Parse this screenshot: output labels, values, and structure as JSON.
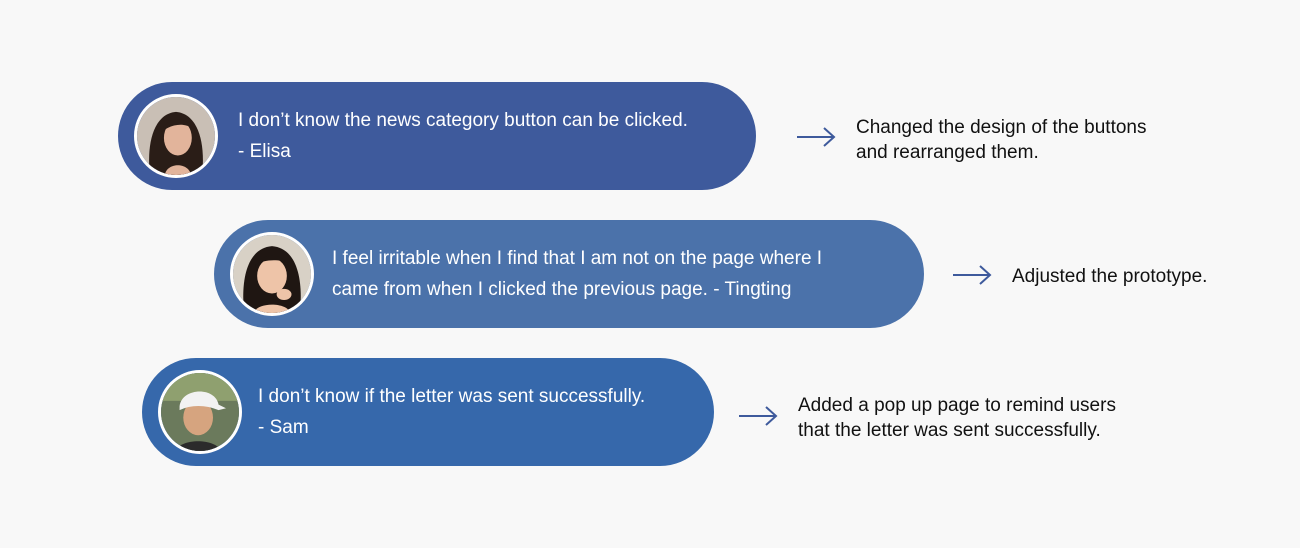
{
  "feedback": [
    {
      "quote": "I don’t know the news category button can be clicked.",
      "author": "- Elisa",
      "response_line1": "Changed the design of the buttons",
      "response_line2": "and rearranged them.",
      "pill_color": "#3e5a9c"
    },
    {
      "quote_line1": "I feel irritable when I find that I am not on the page where I",
      "quote_line2": "came from when I clicked the previous page.  - Tingting",
      "response_line1": "Adjusted the prototype.",
      "pill_color": "#4b72aa"
    },
    {
      "quote": "I don’t know if the letter was sent successfully.",
      "author": "- Sam",
      "response_line1": "Added a pop up page to remind users",
      "response_line2": "that the letter was sent successfully.",
      "pill_color": "#3668ab"
    }
  ],
  "arrow_color": "#3e5a9c",
  "icons": [
    "avatar-elisa",
    "avatar-tingting",
    "avatar-sam",
    "right-arrow-icon"
  ]
}
